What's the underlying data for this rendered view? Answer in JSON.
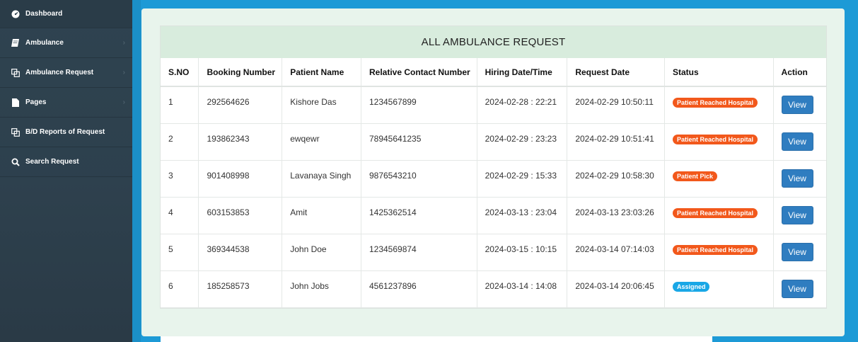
{
  "sidebar": {
    "items": [
      {
        "label": "Dashboard",
        "icon": "dashboard-icon"
      },
      {
        "label": "Ambulance",
        "icon": "ambulance-book-icon"
      },
      {
        "label": "Ambulance Request",
        "icon": "copy-request-icon"
      },
      {
        "label": "Pages",
        "icon": "file-icon"
      },
      {
        "label": "B/D Reports of Request",
        "icon": "copy-report-icon"
      },
      {
        "label": "Search Request",
        "icon": "search-icon"
      }
    ]
  },
  "panel": {
    "title": "ALL AMBULANCE REQUEST",
    "columns": [
      "S.NO",
      "Booking Number",
      "Patient Name",
      "Relative Contact Number",
      "Hiring Date/Time",
      "Request Date",
      "Status",
      "Action"
    ],
    "rows": [
      {
        "sno": "1",
        "booking": "292564626",
        "patient": "Kishore Das",
        "contact": "1234567899",
        "hiring": "2024-02-28 : 22:21",
        "request": "2024-02-29 10:50:11",
        "status": "Patient Reached Hospital",
        "status_color": "#f2581b",
        "action": "View"
      },
      {
        "sno": "2",
        "booking": "193862343",
        "patient": "ewqewr",
        "contact": "78945641235",
        "hiring": "2024-02-29 : 23:23",
        "request": "2024-02-29 10:51:41",
        "status": "Patient Reached Hospital",
        "status_color": "#f2581b",
        "action": "View"
      },
      {
        "sno": "3",
        "booking": "901408998",
        "patient": "Lavanaya Singh",
        "contact": "9876543210",
        "hiring": "2024-02-29 : 15:33",
        "request": "2024-02-29 10:58:30",
        "status": "Patient Pick",
        "status_color": "#f2581b",
        "action": "View"
      },
      {
        "sno": "4",
        "booking": "603153853",
        "patient": "Amit",
        "contact": "1425362514",
        "hiring": "2024-03-13 : 23:04",
        "request": "2024-03-13 23:03:26",
        "status": "Patient Reached Hospital",
        "status_color": "#f2581b",
        "action": "View"
      },
      {
        "sno": "5",
        "booking": "369344538",
        "patient": "John Doe",
        "contact": "1234569874",
        "hiring": "2024-03-15 : 10:15",
        "request": "2024-03-14 07:14:03",
        "status": "Patient Reached Hospital",
        "status_color": "#f2581b",
        "action": "View"
      },
      {
        "sno": "6",
        "booking": "185258573",
        "patient": "John Jobs",
        "contact": "4561237896",
        "hiring": "2024-03-14 : 14:08",
        "request": "2024-03-14 20:06:45",
        "status": "Assigned",
        "status_color": "#19a7e6",
        "action": "View"
      }
    ]
  }
}
